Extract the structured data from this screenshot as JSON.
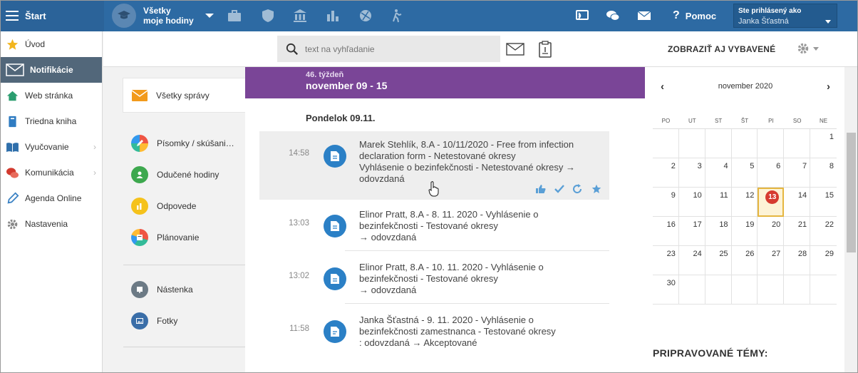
{
  "topbar": {
    "start_label": "Štart",
    "selector_line1": "Všetky",
    "selector_line2": "moje hodiny",
    "help_label": "Pomoc",
    "user_title": "Ste prihlásený ako",
    "user_name": "Janka Šťastná",
    "icons": [
      "briefcase-icon",
      "shield-icon",
      "school-icon",
      "chart-icon",
      "ball-icon",
      "walking-icon",
      "cast-icon",
      "chat-icon",
      "mail-icon"
    ]
  },
  "sidebar": {
    "items": [
      {
        "label": "Úvod",
        "icon": "star-icon"
      },
      {
        "label": "Notifikácie",
        "icon": "envelope-icon"
      },
      {
        "label": "Web stránka",
        "icon": "home-icon"
      },
      {
        "label": "Triedna kniha",
        "icon": "book-icon"
      },
      {
        "label": "Vyučovanie",
        "icon": "open-book-icon"
      },
      {
        "label": "Komunikácia",
        "icon": "chat-bubbles-icon"
      },
      {
        "label": "Agenda Online",
        "icon": "pen-icon"
      },
      {
        "label": "Nastavenia",
        "icon": "gear-icon"
      }
    ]
  },
  "subbar": {
    "search_placeholder": "text na vyhľadanie",
    "show_selected": "ZOBRAZIŤ AJ VYBAVENÉ"
  },
  "leftmenu": {
    "all": "Všetky správy",
    "group1": [
      "Písomky / skúšani…",
      "Odučené hodiny",
      "Odpovede",
      "Plánovanie"
    ],
    "group2": [
      "Nástenka",
      "Fotky"
    ]
  },
  "feed": {
    "week_label": "46. týždeň",
    "week_range": "november 09 - 15",
    "day_label": "Pondelok 09.11.",
    "items": [
      {
        "time": "14:58",
        "line1": "Marek Stehlík, 8.A - 10/11/2020 - Free from infection",
        "line2": "declaration form - Netestované okresy",
        "line3": "Vyhlásenie o bezinfekčnosti - Netestované okresy →",
        "line4": "odovzdaná"
      },
      {
        "time": "13:03",
        "line1": "Elinor Pratt, 8.A - 8. 11. 2020 - Vyhlásenie o",
        "line2": "bezinfekčnosti - Testované okresy",
        "line3": "→ odovzdaná",
        "line4": ""
      },
      {
        "time": "13:02",
        "line1": "Elinor Pratt, 8.A - 10. 11. 2020 - Vyhlásenie o",
        "line2": "bezinfekčnosti - Testované okresy",
        "line3": "→ odovzdaná",
        "line4": ""
      },
      {
        "time": "11:58",
        "line1": "Janka Šťastná - 9. 11. 2020 - Vyhlásenie o",
        "line2": "bezinfekčnosti zamestnanca - Testované okresy",
        "line3": ": odovzdaná → Akceptované",
        "line4": ""
      }
    ]
  },
  "calendar": {
    "month": "november 2020",
    "prev": "‹",
    "next": "›",
    "dow": [
      "PO",
      "UT",
      "ST",
      "ŠT",
      "PI",
      "SO",
      "NE"
    ],
    "cells": [
      "",
      "",
      "",
      "",
      "",
      "",
      "1",
      "2",
      "3",
      "4",
      "5",
      "6",
      "7",
      "8",
      "9",
      "10",
      "11",
      "12",
      "13",
      "14",
      "15",
      "16",
      "17",
      "18",
      "19",
      "20",
      "21",
      "22",
      "23",
      "24",
      "25",
      "26",
      "27",
      "28",
      "29",
      "30",
      "",
      "",
      "",
      "",
      "",
      ""
    ],
    "badge": "13",
    "today": "13",
    "upcoming_title": "PRIPRAVOVANÉ TÉMY:"
  }
}
